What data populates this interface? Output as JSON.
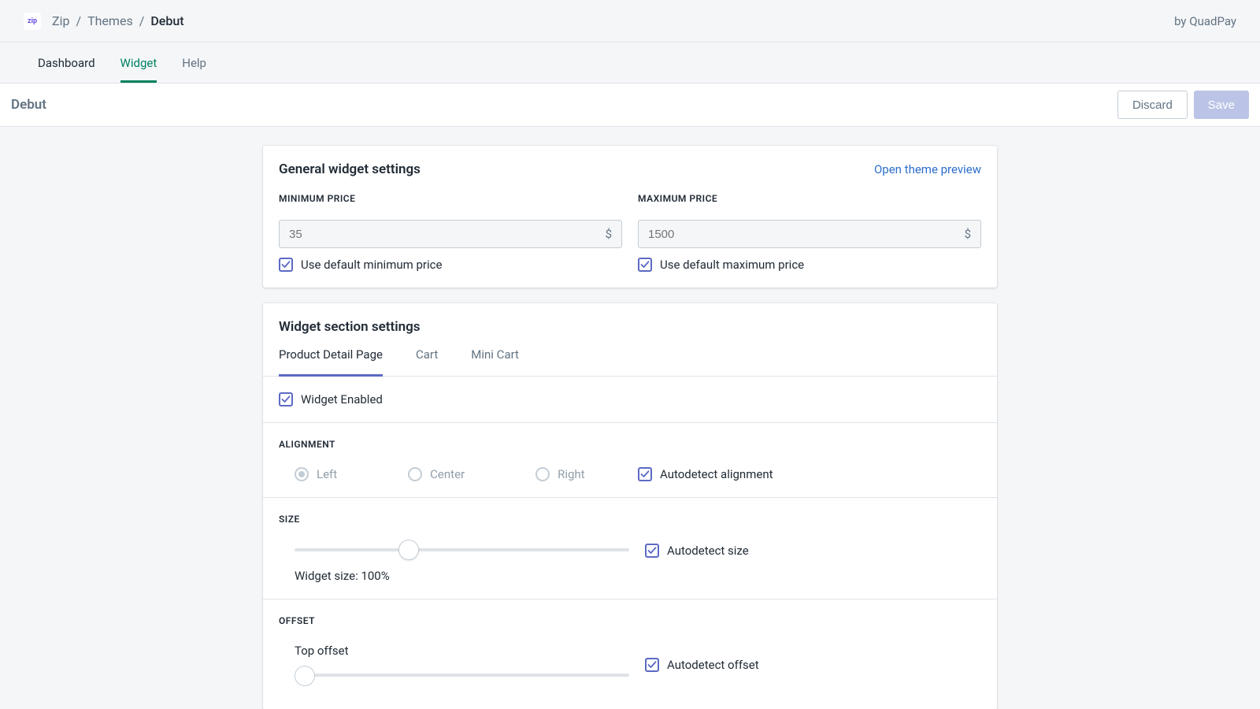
{
  "breadcrumb": {
    "logo_text": "zip",
    "items": [
      "Zip",
      "Themes"
    ],
    "current": "Debut",
    "sep": "/"
  },
  "by_tag": "by QuadPay",
  "main_tabs": {
    "dashboard": "Dashboard",
    "widget": "Widget",
    "help": "Help"
  },
  "page": {
    "title": "Debut",
    "discard": "Discard",
    "save": "Save"
  },
  "general": {
    "title": "General widget settings",
    "preview_link": "Open theme preview",
    "min_label": "MINIMUM PRICE",
    "min_placeholder": "35",
    "min_currency": "$",
    "min_checkbox": "Use default minimum price",
    "max_label": "MAXIMUM PRICE",
    "max_placeholder": "1500",
    "max_currency": "$",
    "max_checkbox": "Use default maximum price"
  },
  "section": {
    "title": "Widget section settings",
    "tabs": {
      "pdp": "Product Detail Page",
      "cart": "Cart",
      "minicart": "Mini Cart"
    },
    "enabled": "Widget Enabled",
    "alignment": {
      "label": "ALIGNMENT",
      "left": "Left",
      "center": "Center",
      "right": "Right",
      "auto": "Autodetect alignment"
    },
    "size": {
      "label": "SIZE",
      "value_text": "Widget size: 100%",
      "auto": "Autodetect size"
    },
    "offset": {
      "label": "OFFSET",
      "top": "Top offset",
      "auto": "Autodetect offset"
    }
  }
}
